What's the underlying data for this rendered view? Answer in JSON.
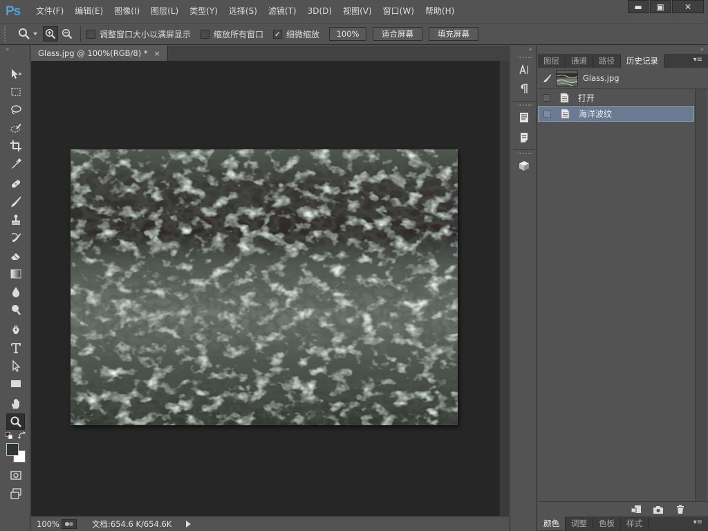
{
  "app": {
    "logo": "Ps"
  },
  "menu": [
    "文件(F)",
    "编辑(E)",
    "图像(I)",
    "图层(L)",
    "类型(Y)",
    "选择(S)",
    "滤镜(T)",
    "3D(D)",
    "视图(V)",
    "窗口(W)",
    "帮助(H)"
  ],
  "window_controls": {
    "minimize": "▬",
    "maximize": "▣",
    "close": "✕"
  },
  "options_bar": {
    "resize_windows_label": "调整窗口大小以满屏显示",
    "zoom_all_label": "缩放所有窗口",
    "scrubby_zoom_label": "细微缩放",
    "resize_windows_checked": false,
    "zoom_all_checked": false,
    "scrubby_zoom_checked": true,
    "btn_100": "100%",
    "btn_fit": "适合屏幕",
    "btn_fill": "填充屏幕"
  },
  "toolbar": {
    "collapse": "»",
    "tools": [
      "move-tool",
      "marquee-tool",
      "lasso-tool",
      "quick-select-tool",
      "crop-tool",
      "eyedropper-tool",
      "healing-brush-tool",
      "brush-tool",
      "clone-stamp-tool",
      "history-brush-tool",
      "eraser-tool",
      "gradient-tool",
      "blur-tool",
      "dodge-tool",
      "pen-tool",
      "type-tool",
      "path-select-tool",
      "rectangle-tool",
      "hand-tool",
      "zoom-tool"
    ],
    "active_tool": "zoom-tool",
    "foreground_color": "#2d3635",
    "background_color": "#ffffff"
  },
  "document": {
    "tab_title": "Glass.jpg @ 100%(RGB/8) *",
    "tab_close": "×",
    "zoom": "100%",
    "doc_info": "文档:654.6 K/654.6K"
  },
  "middock": {
    "collapse": "«",
    "buttons": [
      "character-panel",
      "paragraph-panel",
      "notes-panel",
      "properties-panel",
      "3d-panel"
    ]
  },
  "right_panel": {
    "collapse": "«",
    "tabs": [
      "图层",
      "通道",
      "路径",
      "历史记录"
    ],
    "active_tab": "历史记录",
    "menu_icon": "▾≡",
    "snapshot_label": "Glass.jpg",
    "history": [
      {
        "label": "打开",
        "selected": false
      },
      {
        "label": "海洋波纹",
        "selected": true
      }
    ],
    "bottom_tabs": [
      "颜色",
      "调整",
      "色板",
      "样式"
    ],
    "bottom_active": "颜色"
  },
  "colors": {
    "accent_logo": "#4aa3df",
    "selected_row": "#6a7a92",
    "canvas_bg": "#262626"
  }
}
